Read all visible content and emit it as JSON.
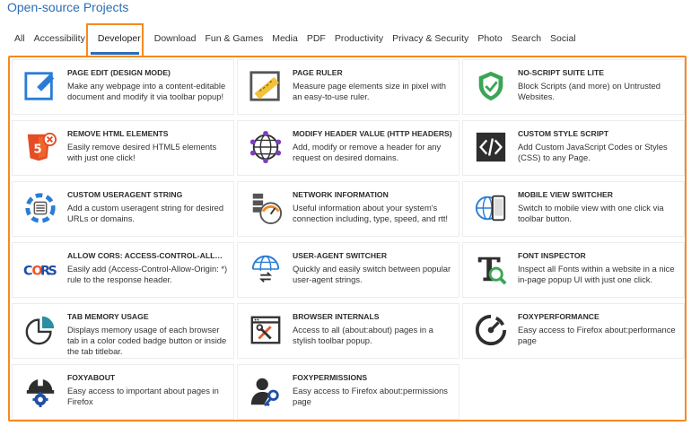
{
  "page": {
    "title": "Open-source Projects"
  },
  "tabs": [
    {
      "label": "All"
    },
    {
      "label": "Accessibility"
    },
    {
      "label": "Developer",
      "active": true
    },
    {
      "label": "Download"
    },
    {
      "label": "Fun & Games"
    },
    {
      "label": "Media"
    },
    {
      "label": "PDF"
    },
    {
      "label": "Productivity"
    },
    {
      "label": "Privacy & Security"
    },
    {
      "label": "Photo"
    },
    {
      "label": "Search"
    },
    {
      "label": "Social"
    }
  ],
  "colors": {
    "accent": "#2a6db5",
    "highlight": "#f48a20"
  },
  "projects": [
    {
      "title": "PAGE EDIT (DESIGN MODE)",
      "desc": "Make any webpage into a content-editable document and modify it via toolbar popup!",
      "icon": "edit-pencil-icon"
    },
    {
      "title": "PAGE RULER",
      "desc": "Measure page elements size in pixel with an easy-to-use ruler.",
      "icon": "ruler-icon"
    },
    {
      "title": "NO-SCRIPT SUITE LITE",
      "desc": "Block Scripts (and more) on Untrusted Websites.",
      "icon": "shield-check-icon"
    },
    {
      "title": "REMOVE HTML ELEMENTS",
      "desc": "Easily remove desired HTML5 elements with just one click!",
      "icon": "html5-remove-icon"
    },
    {
      "title": "MODIFY HEADER VALUE (HTTP HEADERS)",
      "desc": "Add, modify or remove a header for any request on desired domains.",
      "icon": "globe-network-icon"
    },
    {
      "title": "CUSTOM STYLE SCRIPT",
      "desc": "Add Custom JavaScript Codes or Styles (CSS) to any Page.",
      "icon": "code-brackets-icon"
    },
    {
      "title": "CUSTOM USERAGENT STRING",
      "desc": "Add a custom useragent string for desired URLs or domains.",
      "icon": "useragent-string-icon"
    },
    {
      "title": "NETWORK INFORMATION",
      "desc": "Useful information about your system's connection including, type, speed, and rtt!",
      "icon": "network-gauge-icon"
    },
    {
      "title": "MOBILE VIEW SWITCHER",
      "desc": "Switch to mobile view with one click via toolbar button.",
      "icon": "mobile-globe-icon"
    },
    {
      "title": "ALLOW CORS: ACCESS-CONTROL-ALLOW-...",
      "desc": "Easily add (Access-Control-Allow-Origin: *) rule to the response header.",
      "icon": "cors-icon"
    },
    {
      "title": "USER-AGENT SWITCHER",
      "desc": "Quickly and easily switch between popular user-agent strings.",
      "icon": "globe-switch-icon"
    },
    {
      "title": "FONT INSPECTOR",
      "desc": "Inspect all Fonts within a website in a nice in-page popup UI with just one click.",
      "icon": "font-magnifier-icon"
    },
    {
      "title": "TAB MEMORY USAGE",
      "desc": "Displays memory usage of each browser tab in a color coded badge button or inside the tab titlebar.",
      "icon": "pie-chart-icon"
    },
    {
      "title": "BROWSER INTERNALS",
      "desc": "Access to all (about:about) pages in a stylish toolbar popup.",
      "icon": "browser-tools-icon"
    },
    {
      "title": "FOXYPERFORMANCE",
      "desc": "Easy access to Firefox about:performance page",
      "icon": "speedometer-icon"
    },
    {
      "title": "FOXYABOUT",
      "desc": "Easy access to important about pages in Firefox",
      "icon": "helmet-gear-icon"
    },
    {
      "title": "FOXYPERMISSIONS",
      "desc": "Easy access to Firefox about:permissions page",
      "icon": "user-key-icon"
    }
  ]
}
